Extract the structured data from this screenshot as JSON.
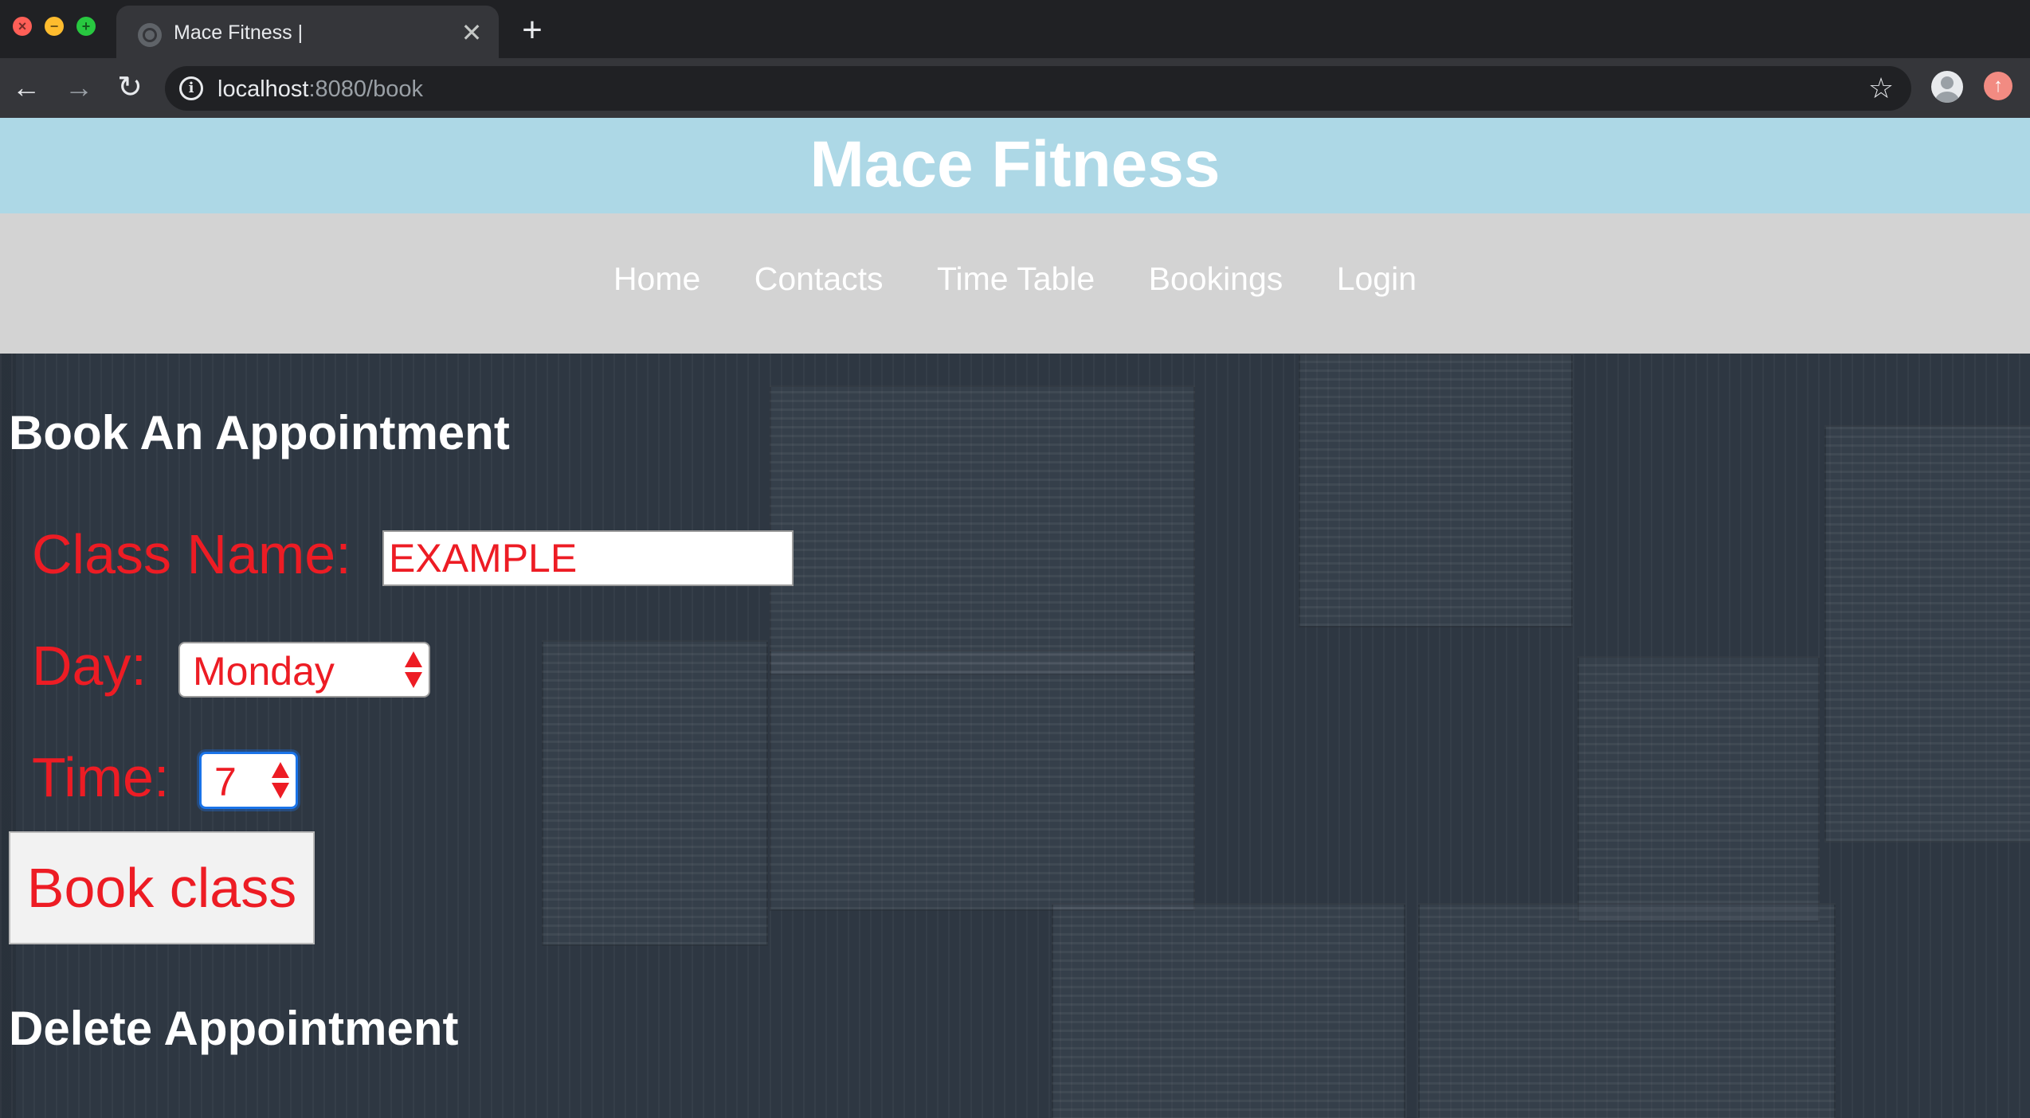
{
  "browser": {
    "tab_title": "Mace Fitness |",
    "url_host": "localhost",
    "url_rest": ":8080/book",
    "icons": {
      "close_window": "close-icon",
      "minimize_window": "minimize-icon",
      "fullscreen_window": "fullscreen-icon",
      "tab_favicon": "globe-icon",
      "tab_close": "close-icon",
      "new_tab": "plus-icon",
      "back": "arrow-left-icon",
      "forward": "arrow-right-icon",
      "reload": "reload-icon",
      "site_info": "info-icon",
      "bookmark": "star-icon",
      "profile": "avatar-icon",
      "update": "update-icon"
    },
    "symbols": {
      "tab_close": "✕",
      "new_tab": "+",
      "back": "←",
      "forward": "→",
      "reload": "↻",
      "info": "i",
      "star": "☆",
      "update": "↑"
    }
  },
  "site": {
    "title": "Mace Fitness",
    "nav": [
      "Home",
      "Contacts",
      "Time Table",
      "Bookings",
      "Login"
    ]
  },
  "booking": {
    "heading": "Book An Appointment",
    "class_label": "Class Name:",
    "class_value": "EXAMPLE",
    "day_label": "Day:",
    "day_value": "Monday",
    "time_label": "Time:",
    "time_value": "7",
    "submit_label": "Book class"
  },
  "delete": {
    "heading": "Delete Appointment"
  },
  "colors": {
    "header_bg": "#add8e6",
    "nav_bg": "#d3d3d3",
    "form_text": "#ed1c24",
    "focus_ring": "#1a73e8"
  }
}
